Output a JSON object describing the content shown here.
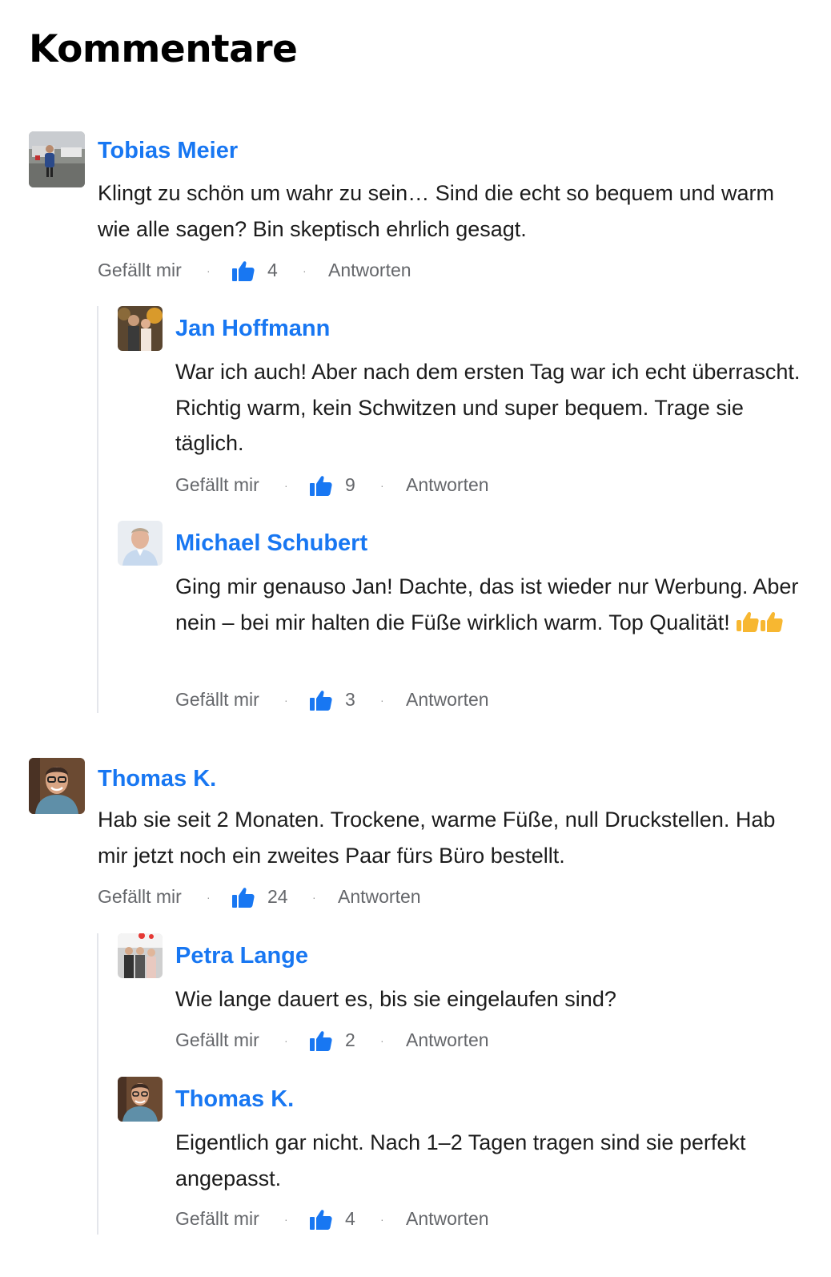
{
  "page": {
    "title": "Kommentare"
  },
  "labels": {
    "like": "Gefällt mir",
    "reply": "Antworten",
    "separator": "·"
  },
  "colors": {
    "name": "#1877f2",
    "thumb_icon": "#1877f2",
    "action_text": "#65676b",
    "thread_line": "#e4e6eb"
  },
  "comments": [
    {
      "author": "Tobias Meier",
      "avatar_icon": "avatar-photo",
      "text": "Klingt zu schön um wahr zu sein… Sind die echt so bequem und warm wie alle sagen? Bin skeptisch ehrlich gesagt.",
      "likes": "4",
      "replies": [
        {
          "author": "Jan Hoffmann",
          "avatar_icon": "avatar-photo",
          "text": "War ich auch! Aber nach dem ersten Tag war ich echt überrascht. Richtig warm, kein Schwitzen und super bequem. Trage sie täglich.",
          "likes": "9"
        },
        {
          "author": "Michael Schubert",
          "avatar_icon": "avatar-photo",
          "text": "Ging mir genauso Jan! Dachte, das ist wieder nur Werbung. Aber nein – bei mir halten die Füße wirklich warm. Top Qualität!",
          "emoji": "thumbs-up-emoji x2",
          "likes": "3"
        }
      ]
    },
    {
      "author": "Thomas K.",
      "avatar_icon": "avatar-photo",
      "text": "Hab sie seit 2 Monaten. Trockene, warme Füße, null Druckstellen. Hab mir jetzt noch ein zweites Paar fürs Büro bestellt.",
      "likes": "24",
      "replies": [
        {
          "author": "Petra Lange",
          "avatar_icon": "avatar-photo",
          "text": "Wie lange dauert es, bis sie eingelaufen sind?",
          "likes": "2"
        },
        {
          "author": "Thomas K.",
          "avatar_icon": "avatar-photo",
          "text": "Eigentlich gar nicht. Nach 1–2 Tagen tragen sind sie perfekt angepasst.",
          "likes": "4"
        }
      ]
    }
  ]
}
